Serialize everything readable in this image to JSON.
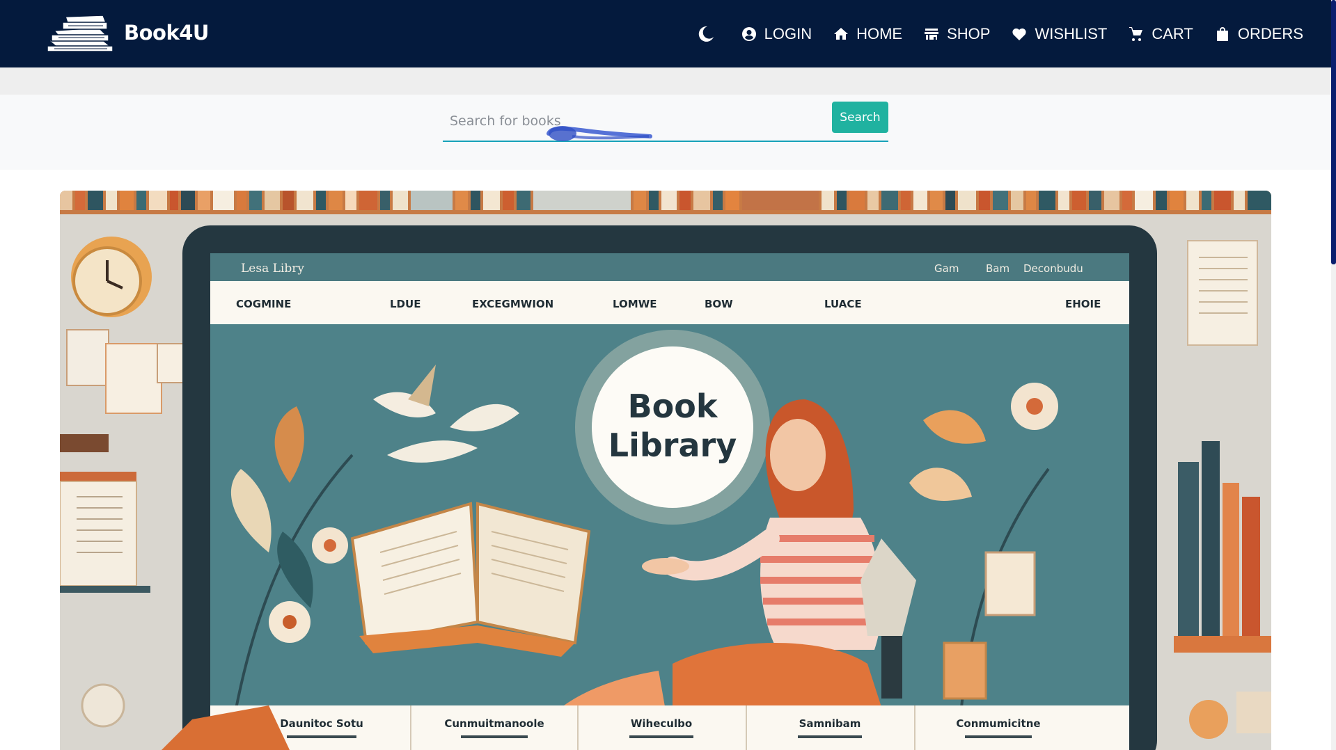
{
  "brand": {
    "name": "Book4U",
    "logo_icon": "book-stack-icon"
  },
  "nav": {
    "theme_icon": "moon-icon",
    "items": [
      {
        "label": "LOGIN",
        "icon": "user-circle-icon"
      },
      {
        "label": "HOME",
        "icon": "home-icon"
      },
      {
        "label": "SHOP",
        "icon": "store-icon"
      },
      {
        "label": "WISHLIST",
        "icon": "heart-icon"
      },
      {
        "label": "CART",
        "icon": "cart-icon"
      },
      {
        "label": "ORDERS",
        "icon": "bag-icon"
      }
    ]
  },
  "search": {
    "placeholder": "Search for books",
    "value": "",
    "button_label": "Search"
  },
  "hero": {
    "title_line1": "Book",
    "title_line2": "Library",
    "screen_title": "Lesa Libry",
    "screen_top_links": [
      "Gam",
      "Bam",
      "Deconbudu"
    ],
    "screen_menu": [
      "COGMINE",
      "LDUE",
      "EXCEGMWION",
      "LOMWE",
      "BOW",
      "LUACE",
      "",
      "EHOIE"
    ],
    "screen_footer": [
      "Daunitoc Sotu",
      "Cunmuitmanoole",
      "Wiheculbo",
      "Samnibam",
      "Conmumicitne"
    ]
  },
  "colors": {
    "navbar_bg": "#041a3d",
    "accent": "#20b2a0",
    "underline": "#17a2b8",
    "hero_teal": "#4a7f86",
    "hero_orange": "#e07a3b"
  }
}
